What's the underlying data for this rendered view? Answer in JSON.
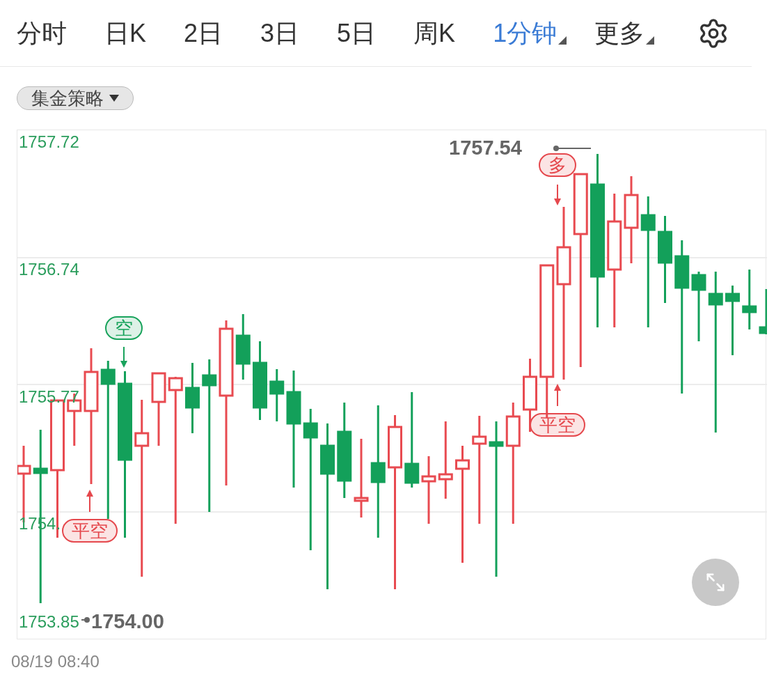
{
  "tabs": [
    {
      "label": "分时",
      "selected": false,
      "kind": "plain"
    },
    {
      "label": "日K",
      "selected": false,
      "kind": "plain"
    },
    {
      "label": "2日",
      "selected": false,
      "kind": "plain"
    },
    {
      "label": "3日",
      "selected": false,
      "kind": "plain"
    },
    {
      "label": "5日",
      "selected": false,
      "kind": "plain"
    },
    {
      "label": "周K",
      "selected": false,
      "kind": "plain"
    },
    {
      "label": "1分钟",
      "selected": true,
      "kind": "dropdown"
    },
    {
      "label": "更多",
      "selected": false,
      "kind": "dropdown"
    }
  ],
  "strategy_chip": {
    "label": "集金策略"
  },
  "chart": {
    "y_axis_labels": [
      "1757.72",
      "1756.74",
      "1755.77",
      "1754.",
      "1753.85"
    ],
    "high_label": "1757.54",
    "low_label": "1754.00",
    "signals": [
      {
        "label": "空",
        "color": "#19a35c",
        "kind": "down"
      },
      {
        "label": "平空",
        "color": "#e5484d",
        "kind": "up"
      },
      {
        "label": "多",
        "color": "#e5484d",
        "kind": "down"
      },
      {
        "label": "平空",
        "color": "#e5484d",
        "kind": "up"
      }
    ]
  },
  "timestamp": "08/19 08:40"
}
